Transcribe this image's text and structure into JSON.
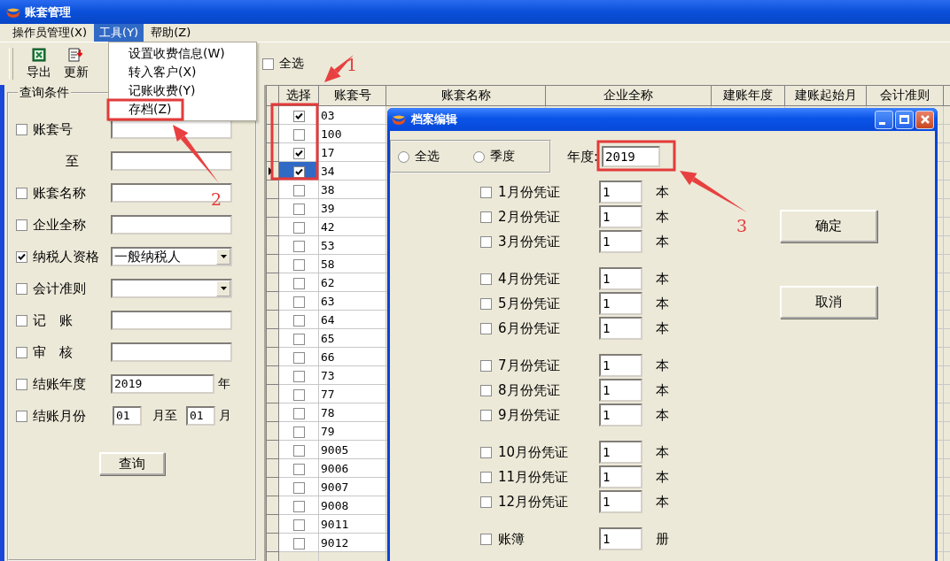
{
  "window": {
    "title": "账套管理"
  },
  "menu": [
    {
      "label": "操作员管理(X)",
      "selected": false
    },
    {
      "label": "工具(Y)",
      "selected": true
    },
    {
      "label": "帮助(Z)",
      "selected": false
    }
  ],
  "menu_dropdown": {
    "items": [
      "设置收费信息(W)",
      "转入客户(X)",
      "记账收费(Y)",
      "存档(Z)"
    ]
  },
  "toolbar": [
    {
      "kind": "export",
      "label": "导出"
    },
    {
      "kind": "refresh",
      "label": "更新"
    }
  ],
  "select_all": {
    "label": "全选",
    "checked": false
  },
  "query": {
    "legend": "查询条件",
    "rows": [
      {
        "kind": "text",
        "checked": false,
        "label": "账套号"
      },
      {
        "kind": "to",
        "label": "至"
      },
      {
        "kind": "text",
        "checked": false,
        "label": "账套名称"
      },
      {
        "kind": "text",
        "checked": false,
        "label": "企业全称"
      },
      {
        "kind": "select",
        "checked": true,
        "label": "纳税人资格",
        "value": "一般纳税人"
      },
      {
        "kind": "select",
        "checked": false,
        "label": "会计准则"
      },
      {
        "kind": "text",
        "checked": false,
        "label": "记　账"
      },
      {
        "kind": "text",
        "checked": false,
        "label": "审　核"
      },
      {
        "kind": "year",
        "checked": false,
        "label": "结账年度",
        "value": "2019",
        "unit": "年"
      },
      {
        "kind": "months",
        "checked": false,
        "label": "结账月份",
        "from": "01",
        "mid": "月至",
        "to": "01",
        "unit": "月"
      }
    ],
    "button": "查询"
  },
  "grid": {
    "columns": [
      "选择",
      "账套号",
      "账套名称",
      "企业全称",
      "建账年度",
      "建账起始月",
      "会计准则"
    ],
    "rows": [
      {
        "checked": true,
        "id": "03",
        "selected": false
      },
      {
        "checked": false,
        "id": "100",
        "selected": false
      },
      {
        "checked": true,
        "id": "17",
        "selected": false
      },
      {
        "checked": true,
        "id": "34",
        "selected": true
      },
      {
        "checked": false,
        "id": "38",
        "selected": false
      },
      {
        "checked": false,
        "id": "39",
        "selected": false
      },
      {
        "checked": false,
        "id": "42",
        "selected": false
      },
      {
        "checked": false,
        "id": "53",
        "selected": false
      },
      {
        "checked": false,
        "id": "58",
        "selected": false
      },
      {
        "checked": false,
        "id": "62",
        "selected": false
      },
      {
        "checked": false,
        "id": "63",
        "selected": false
      },
      {
        "checked": false,
        "id": "64",
        "selected": false
      },
      {
        "checked": false,
        "id": "65",
        "selected": false
      },
      {
        "checked": false,
        "id": "66",
        "selected": false
      },
      {
        "checked": false,
        "id": "73",
        "selected": false
      },
      {
        "checked": false,
        "id": "77",
        "selected": false
      },
      {
        "checked": false,
        "id": "78",
        "selected": false
      },
      {
        "checked": false,
        "id": "79",
        "selected": false
      },
      {
        "checked": false,
        "id": "9005",
        "selected": false
      },
      {
        "checked": false,
        "id": "9006",
        "selected": false
      },
      {
        "checked": false,
        "id": "9007",
        "selected": false
      },
      {
        "checked": false,
        "id": "9008",
        "selected": false
      },
      {
        "checked": false,
        "id": "9011",
        "selected": false
      },
      {
        "checked": false,
        "id": "9012",
        "selected": false
      }
    ]
  },
  "dialog": {
    "title": "档案编辑",
    "period_options": [
      {
        "label": "全选",
        "selected": false
      },
      {
        "label": "季度",
        "selected": false
      }
    ],
    "year_label": "年度:",
    "year": "2019",
    "voucher_groups": [
      [
        {
          "label": "1月份凭证",
          "checked": false,
          "count": "1",
          "unit": "本"
        },
        {
          "label": "2月份凭证",
          "checked": false,
          "count": "1",
          "unit": "本"
        },
        {
          "label": "3月份凭证",
          "checked": false,
          "count": "1",
          "unit": "本"
        }
      ],
      [
        {
          "label": "4月份凭证",
          "checked": false,
          "count": "1",
          "unit": "本"
        },
        {
          "label": "5月份凭证",
          "checked": false,
          "count": "1",
          "unit": "本"
        },
        {
          "label": "6月份凭证",
          "checked": false,
          "count": "1",
          "unit": "本"
        }
      ],
      [
        {
          "label": "7月份凭证",
          "checked": false,
          "count": "1",
          "unit": "本"
        },
        {
          "label": "8月份凭证",
          "checked": false,
          "count": "1",
          "unit": "本"
        },
        {
          "label": "9月份凭证",
          "checked": false,
          "count": "1",
          "unit": "本"
        }
      ],
      [
        {
          "label": "10月份凭证",
          "checked": false,
          "count": "1",
          "unit": "本"
        },
        {
          "label": "11月份凭证",
          "checked": false,
          "count": "1",
          "unit": "本"
        },
        {
          "label": "12月份凭证",
          "checked": false,
          "count": "1",
          "unit": "本"
        }
      ]
    ],
    "ledger": {
      "label": "账簿",
      "checked": false,
      "count": "1",
      "unit": "册"
    },
    "buttons": [
      "确定",
      "取消"
    ]
  },
  "annotations": [
    {
      "label": "1"
    },
    {
      "label": "2"
    },
    {
      "label": "3"
    }
  ]
}
